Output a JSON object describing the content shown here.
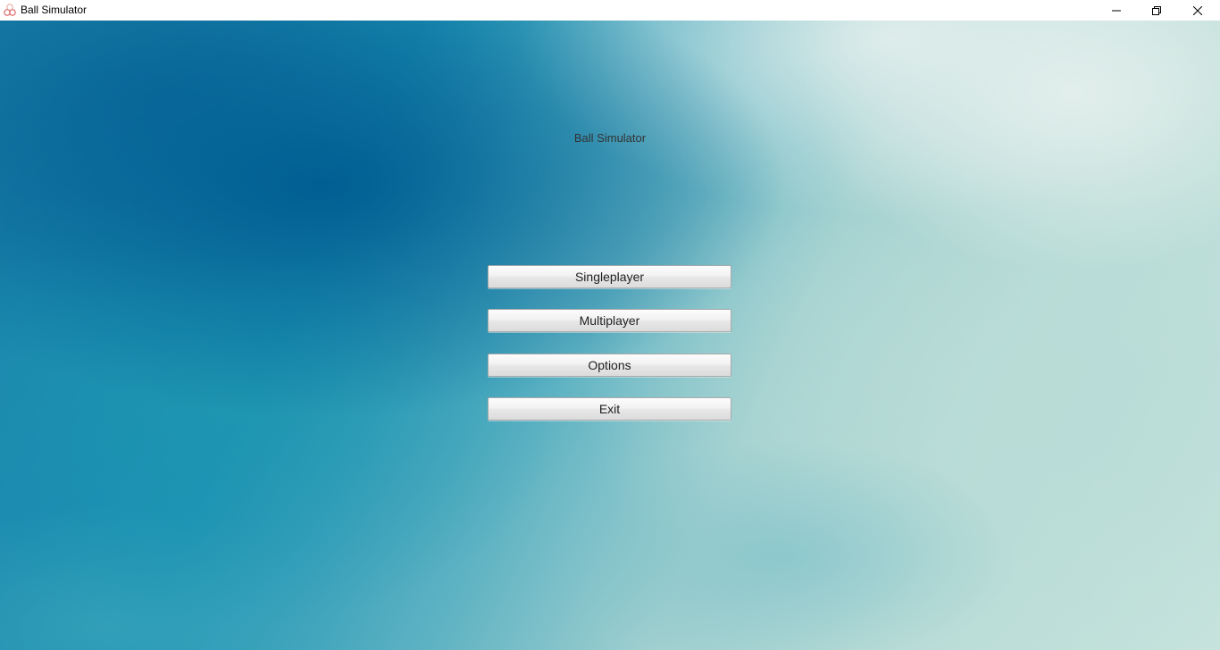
{
  "window": {
    "title": "Ball Simulator",
    "icon": "app-icon",
    "controls": {
      "minimize_icon": "minimize-icon",
      "maximize_icon": "restore-icon",
      "close_icon": "close-icon"
    }
  },
  "menu": {
    "title": "Ball Simulator",
    "buttons": [
      {
        "label": "Singleplayer"
      },
      {
        "label": "Multiplayer"
      },
      {
        "label": "Options"
      },
      {
        "label": "Exit"
      }
    ]
  },
  "colors": {
    "background_deep": "#005c91",
    "background_light": "#c7e3dd",
    "button_face": "#f2f2f2",
    "button_border": "#a9a9a9"
  }
}
